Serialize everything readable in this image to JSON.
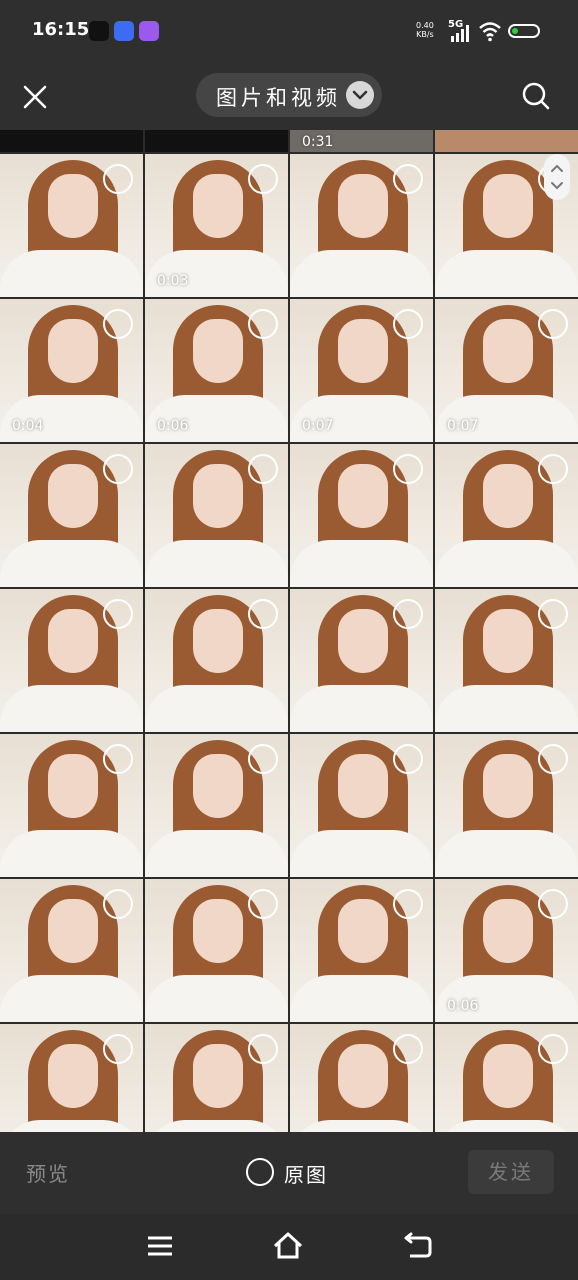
{
  "status_bar": {
    "time": "16:15",
    "net_speed_value": "0.40",
    "net_speed_unit": "KB/s",
    "network_type": "5G",
    "app_icons": [
      "tiktok-icon",
      "app-badge-icon",
      "purple-app-icon"
    ],
    "app_icon_colors": [
      "#111111",
      "#3d6cf2",
      "#9b59f0"
    ],
    "battery_color": "#2ecc40"
  },
  "toolbar": {
    "album_title": "图片和视频",
    "close_icon": "close-icon",
    "search_icon": "search-icon",
    "dropdown_icon": "chevron-down-icon"
  },
  "grid": {
    "top_strip_duration": "0:31",
    "rows": [
      [
        {
          "duration": ""
        },
        {
          "duration": "0:03"
        },
        {
          "duration": ""
        },
        {
          "duration": ""
        }
      ],
      [
        {
          "duration": "0:04"
        },
        {
          "duration": "0:06"
        },
        {
          "duration": "0:07"
        },
        {
          "duration": "0:07"
        }
      ],
      [
        {
          "duration": ""
        },
        {
          "duration": ""
        },
        {
          "duration": ""
        },
        {
          "duration": ""
        }
      ],
      [
        {
          "duration": ""
        },
        {
          "duration": ""
        },
        {
          "duration": ""
        },
        {
          "duration": ""
        }
      ],
      [
        {
          "duration": ""
        },
        {
          "duration": ""
        },
        {
          "duration": ""
        },
        {
          "duration": ""
        }
      ],
      [
        {
          "duration": ""
        },
        {
          "duration": ""
        },
        {
          "duration": ""
        },
        {
          "duration": "0:06"
        }
      ],
      [
        {
          "duration": ""
        },
        {
          "duration": ""
        },
        {
          "duration": ""
        },
        {
          "duration": ""
        }
      ]
    ]
  },
  "bottom_bar": {
    "preview_label": "预览",
    "original_label": "原图",
    "send_label": "发送"
  },
  "nav_bar": {
    "menu_icon": "menu-icon",
    "home_icon": "home-icon",
    "back_icon": "back-icon"
  }
}
